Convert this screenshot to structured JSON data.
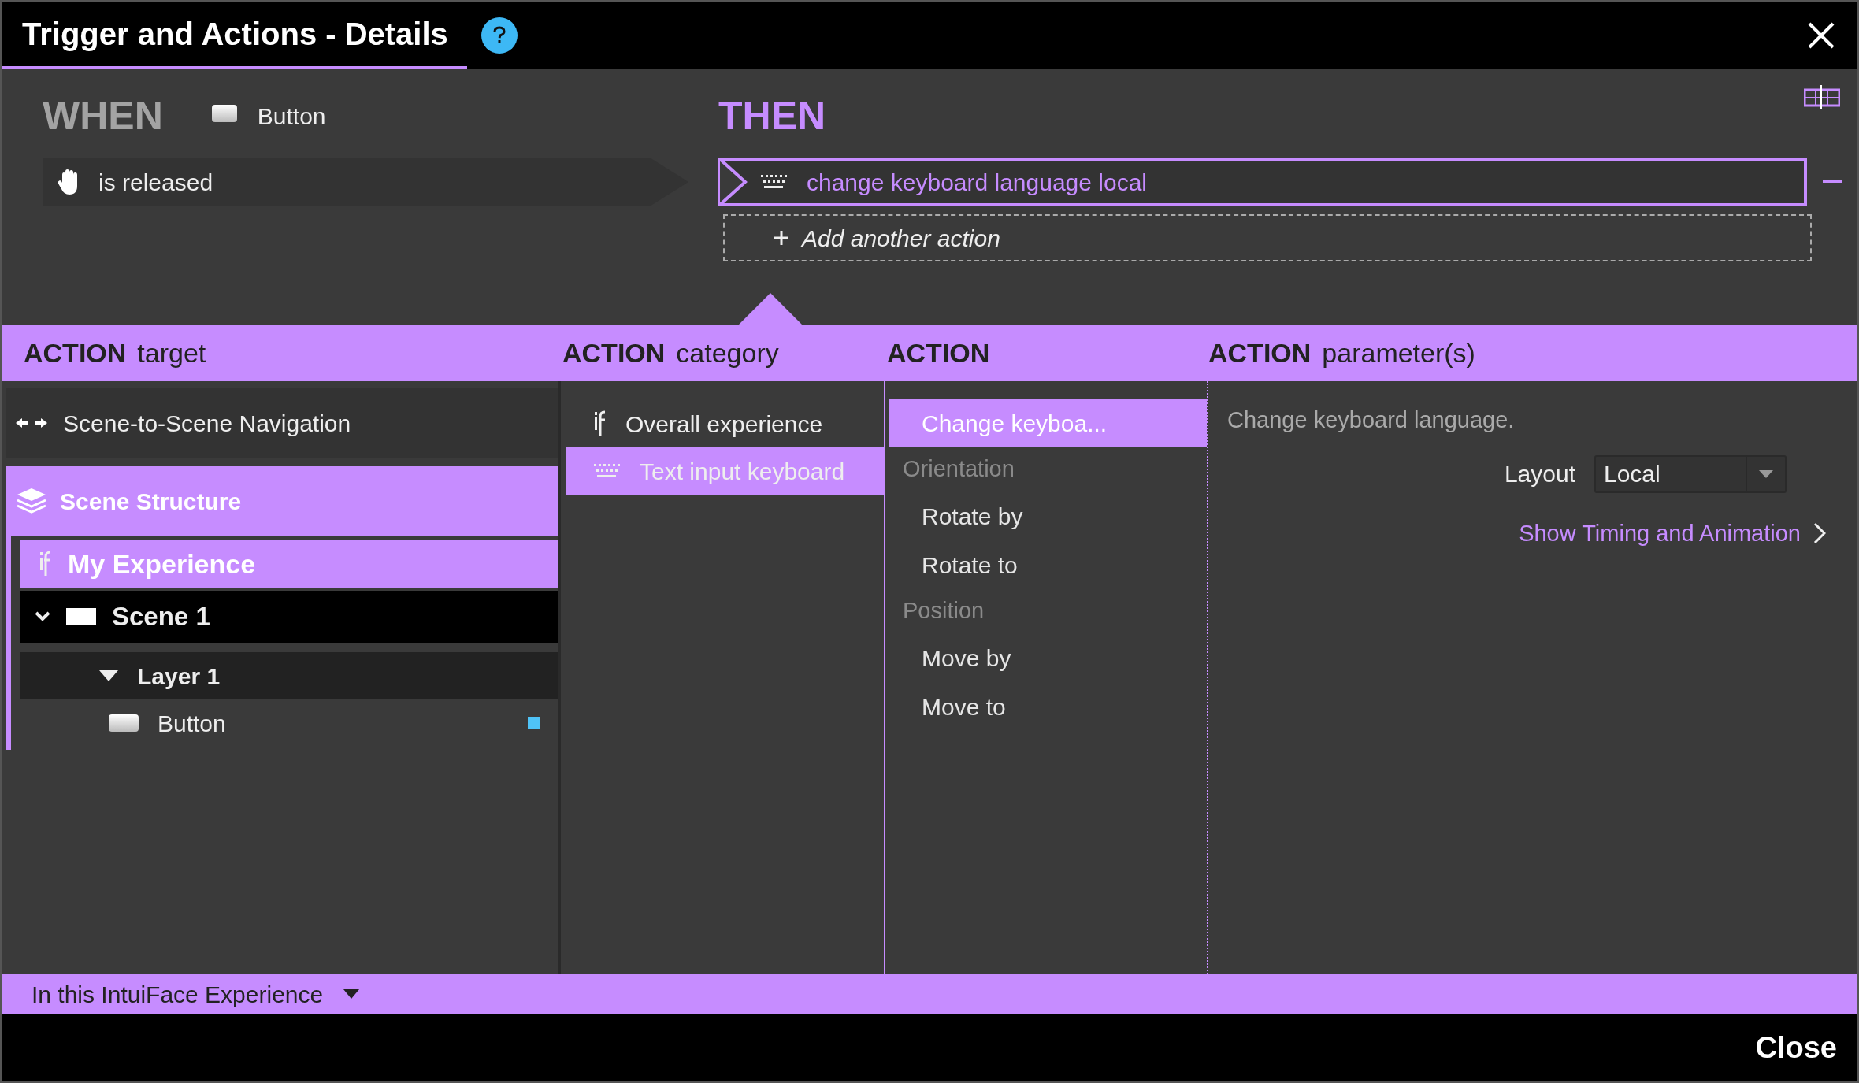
{
  "window": {
    "title": "Trigger and Actions - Details"
  },
  "when": {
    "heading": "WHEN",
    "source": "Button",
    "trigger": "is released"
  },
  "then": {
    "heading": "THEN",
    "action": "change keyboard language local",
    "add_label": "Add another action"
  },
  "columns": [
    {
      "bold": "ACTION",
      "light": "target"
    },
    {
      "bold": "ACTION",
      "light": "category"
    },
    {
      "bold": "ACTION"
    },
    {
      "bold": "ACTION",
      "light": "parameter(s)"
    }
  ],
  "target": {
    "navigation": "Scene-to-Scene Navigation",
    "structure": "Scene Structure",
    "tree": [
      {
        "label": "My Experience",
        "kind": "experience",
        "children": [
          {
            "label": "Scene 1",
            "kind": "scene",
            "expanded": true,
            "children": [
              {
                "label": "Layer 1",
                "kind": "layer",
                "expanded": true,
                "children": [
                  {
                    "label": "Button",
                    "kind": "button",
                    "color": "#4fc3f7"
                  }
                ]
              }
            ]
          }
        ]
      }
    ]
  },
  "categories": [
    {
      "label": "Overall experience",
      "kind": "experience",
      "selected": false
    },
    {
      "label": "Text input keyboard",
      "kind": "keyboard",
      "selected": true
    }
  ],
  "actions": [
    {
      "label": "Change keyboa...",
      "kind": "item",
      "selected": true
    },
    {
      "label": "Orientation",
      "kind": "group"
    },
    {
      "label": "Rotate by",
      "kind": "item",
      "selected": false
    },
    {
      "label": "Rotate to",
      "kind": "item",
      "selected": false
    },
    {
      "label": "Position",
      "kind": "group"
    },
    {
      "label": "Move by",
      "kind": "item",
      "selected": false
    },
    {
      "label": "Move to",
      "kind": "item",
      "selected": false
    }
  ],
  "parameters": {
    "description": "Change keyboard language.",
    "layout_label": "Layout",
    "layout_value": "Local",
    "link": "Show Timing and Animation"
  },
  "footer": {
    "scope": "In this IntuiFace Experience",
    "close": "Close"
  }
}
